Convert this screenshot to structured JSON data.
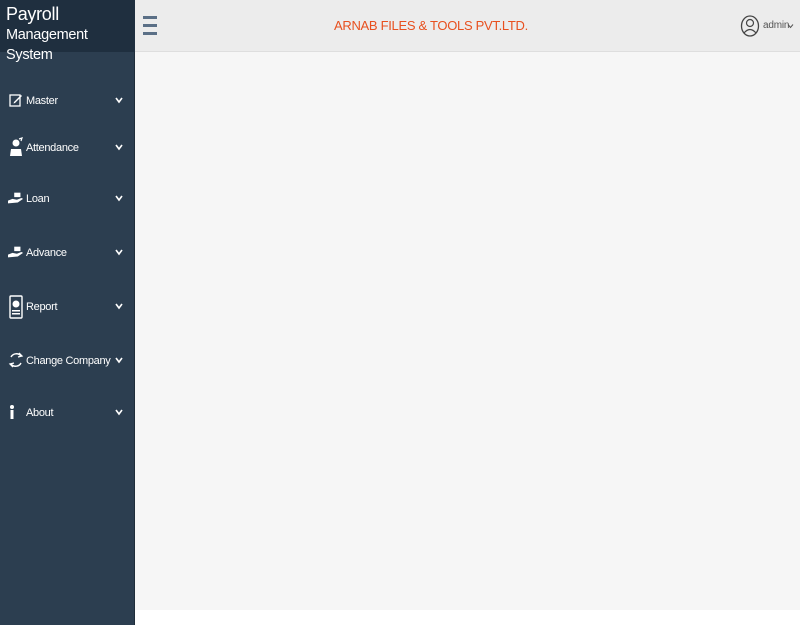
{
  "brand": {
    "line1": "Payroll",
    "line2": "Management System"
  },
  "header": {
    "company_name": "ARNAB FILES & TOOLS PVT.LTD.",
    "user_name": "admin"
  },
  "sidebar": {
    "items": [
      {
        "label": "Master",
        "icon": "edit-icon"
      },
      {
        "label": "Attendance",
        "icon": "attendance-icon"
      },
      {
        "label": "Loan",
        "icon": "hand-money-icon"
      },
      {
        "label": "Advance",
        "icon": "hand-money-icon"
      },
      {
        "label": "Report",
        "icon": "report-icon"
      },
      {
        "label": "Change Company",
        "icon": "refresh-icon"
      },
      {
        "label": "About",
        "icon": "info-icon"
      }
    ]
  },
  "colors": {
    "sidebar_bg": "#2c3e50",
    "brand_bg": "#1f2f3f",
    "header_bg": "#ececec",
    "company_text": "#e8501f",
    "content_bg": "#f6f6f6"
  }
}
